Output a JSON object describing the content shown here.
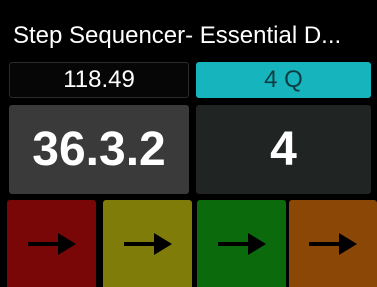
{
  "header": {
    "title": "Step Sequencer- Essential D..."
  },
  "tempo": {
    "value": "118.49"
  },
  "quantize": {
    "value": "4 Q",
    "color": "#16b4bc"
  },
  "position": {
    "value": "36.3.2"
  },
  "steps": {
    "value": "4"
  },
  "pads": [
    {
      "icon": "arrow-right-icon",
      "color": "#7a0707"
    },
    {
      "icon": "arrow-right-icon",
      "color": "#7f7c0a"
    },
    {
      "icon": "arrow-right-icon",
      "color": "#0a6a0c"
    },
    {
      "icon": "arrow-right-icon",
      "color": "#8b4706"
    }
  ]
}
